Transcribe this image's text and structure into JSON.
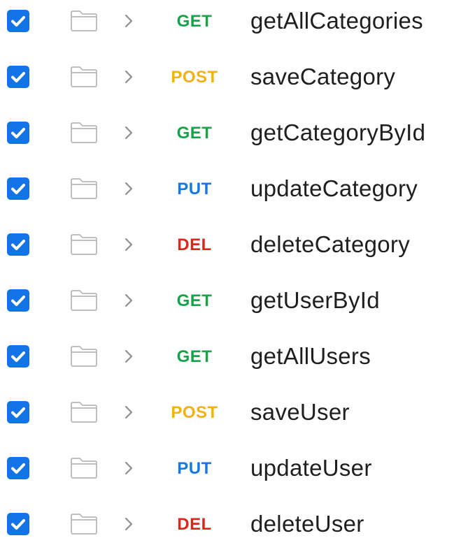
{
  "colors": {
    "checkbox": "#1274e6",
    "GET": "#16a34a",
    "POST": "#f5b013",
    "PUT": "#1677e8",
    "DEL": "#e0231c",
    "folder_stroke": "#b8b8b8",
    "chevron": "#8a8a8a",
    "text": "#1f1f1f"
  },
  "requests": [
    {
      "method": "GET",
      "name": "getAllCategories",
      "checked": true
    },
    {
      "method": "POST",
      "name": "saveCategory",
      "checked": true
    },
    {
      "method": "GET",
      "name": "getCategoryById",
      "checked": true
    },
    {
      "method": "PUT",
      "name": "updateCategory",
      "checked": true
    },
    {
      "method": "DEL",
      "name": "deleteCategory",
      "checked": true
    },
    {
      "method": "GET",
      "name": "getUserById",
      "checked": true
    },
    {
      "method": "GET",
      "name": "getAllUsers",
      "checked": true
    },
    {
      "method": "POST",
      "name": "saveUser",
      "checked": true
    },
    {
      "method": "PUT",
      "name": "updateUser",
      "checked": true
    },
    {
      "method": "DEL",
      "name": "deleteUser",
      "checked": true
    }
  ],
  "icons": {
    "checkbox": "checkmark-icon",
    "folder": "folder-icon",
    "chevron": "chevron-right-icon"
  }
}
